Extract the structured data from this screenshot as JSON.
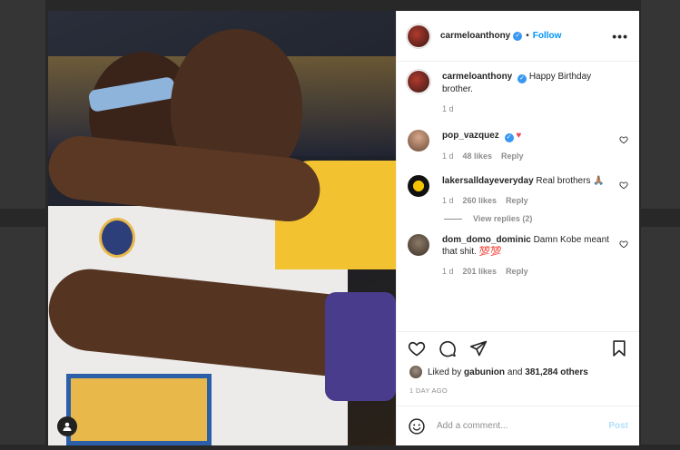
{
  "post": {
    "author": "carmeloanthony",
    "separator": "•",
    "follow_label": "Follow",
    "more_label": "•••",
    "caption": "Happy Birthday brother.",
    "caption_age": "1 d"
  },
  "comments": [
    {
      "user": "pop_vazquez",
      "text": "",
      "verified": true,
      "heart": "♥",
      "age": "1 d",
      "likes": "48 likes",
      "reply": "Reply"
    },
    {
      "user": "lakersalldayeveryday",
      "text": "Real brothers 🙏🏽",
      "age": "1 d",
      "likes": "260 likes",
      "reply": "Reply",
      "view_replies": "View replies (2)"
    },
    {
      "user": "dom_domo_dominic",
      "text": "Damn Kobe meant that shit. 💯💯",
      "age": "1 d",
      "likes": "201 likes",
      "reply": "Reply"
    }
  ],
  "likes": {
    "prefix": "Liked by",
    "user": "gabunion",
    "joiner": "and",
    "count": "381,284 others"
  },
  "time_ago": "1 DAY AGO",
  "composer": {
    "placeholder": "Add a comment...",
    "post_label": "Post"
  },
  "icons": {
    "heart": "heart-icon",
    "comment": "comment-icon",
    "share": "share-icon",
    "save": "bookmark-icon",
    "emoji": "emoji-icon",
    "tag": "user-tag-icon"
  },
  "colors": {
    "accent": "#0095f6",
    "verified": "#3897f0",
    "heart_red": "#ed4956",
    "muted": "#8e8e8e"
  }
}
